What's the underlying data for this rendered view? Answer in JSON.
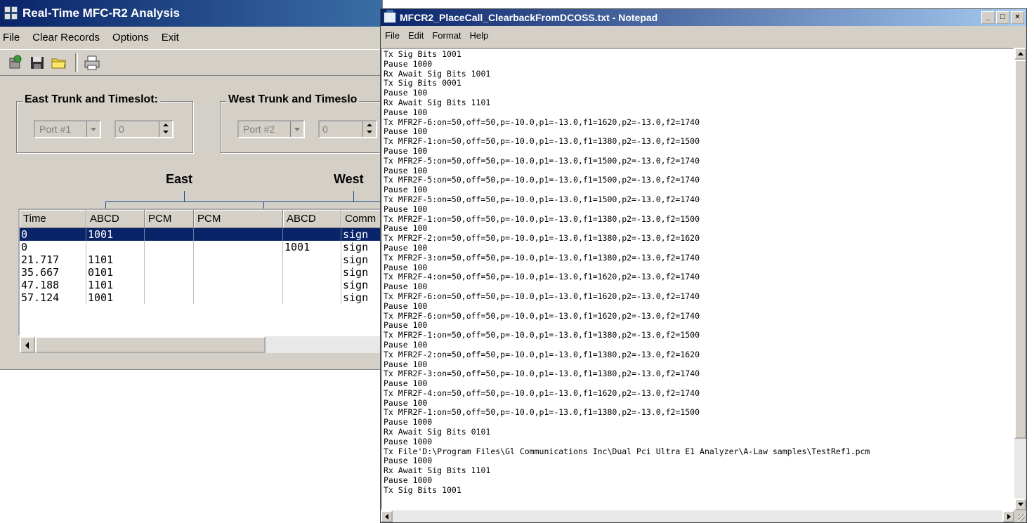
{
  "analysis": {
    "title": "Real-Time MFC-R2 Analysis",
    "menu": [
      "File",
      "Clear Records",
      "Options",
      "Exit"
    ],
    "toolbar": [
      "record-icon",
      "save-icon",
      "open-folder-icon",
      "print-icon"
    ],
    "east_group": {
      "label": "East Trunk and Timeslot:",
      "port": "Port #1",
      "timeslot": "0"
    },
    "west_group": {
      "label": "West Trunk and Timeslo",
      "port": "Port #2",
      "timeslot": "0"
    },
    "east_label": "East",
    "west_label": "West",
    "columns": [
      "Time",
      "ABCD",
      "PCM",
      "PCM",
      "ABCD",
      "Comm"
    ],
    "rows": [
      [
        "0",
        "1001",
        "",
        "",
        "",
        "sign"
      ],
      [
        "0",
        "",
        "",
        "",
        "1001",
        "sign"
      ],
      [
        "21.717",
        "1101",
        "",
        "",
        "",
        "sign"
      ],
      [
        "35.667",
        "0101",
        "",
        "",
        "",
        "sign"
      ],
      [
        "47.188",
        "1101",
        "",
        "",
        "",
        "sign"
      ],
      [
        "57.124",
        "1001",
        "",
        "",
        "",
        "sign"
      ]
    ]
  },
  "notepad": {
    "title": "MFCR2_PlaceCall_ClearbackFromDCOSS.txt - Notepad",
    "menu": [
      "File",
      "Edit",
      "Format",
      "Help"
    ],
    "title_buttons": [
      "_",
      "□",
      "×"
    ],
    "lines": [
      "Tx Sig Bits 1001",
      "Pause 1000",
      "Rx Await Sig Bits 1001",
      "Tx Sig Bits 0001",
      "Pause 100",
      "Rx Await Sig Bits 1101",
      "Pause 100",
      "Tx MFR2F-6:on=50,off=50,p=-10.0,p1=-13.0,f1=1620,p2=-13.0,f2=1740",
      "Pause 100",
      "Tx MFR2F-1:on=50,off=50,p=-10.0,p1=-13.0,f1=1380,p2=-13.0,f2=1500",
      "Pause 100",
      "Tx MFR2F-5:on=50,off=50,p=-10.0,p1=-13.0,f1=1500,p2=-13.0,f2=1740",
      "Pause 100",
      "Tx MFR2F-5:on=50,off=50,p=-10.0,p1=-13.0,f1=1500,p2=-13.0,f2=1740",
      "Pause 100",
      "Tx MFR2F-5:on=50,off=50,p=-10.0,p1=-13.0,f1=1500,p2=-13.0,f2=1740",
      "Pause 100",
      "Tx MFR2F-1:on=50,off=50,p=-10.0,p1=-13.0,f1=1380,p2=-13.0,f2=1500",
      "Pause 100",
      "Tx MFR2F-2:on=50,off=50,p=-10.0,p1=-13.0,f1=1380,p2=-13.0,f2=1620",
      "Pause 100",
      "Tx MFR2F-3:on=50,off=50,p=-10.0,p1=-13.0,f1=1380,p2=-13.0,f2=1740",
      "Pause 100",
      "Tx MFR2F-4:on=50,off=50,p=-10.0,p1=-13.0,f1=1620,p2=-13.0,f2=1740",
      "Pause 100",
      "Tx MFR2F-6:on=50,off=50,p=-10.0,p1=-13.0,f1=1620,p2=-13.0,f2=1740",
      "Pause 100",
      "Tx MFR2F-6:on=50,off=50,p=-10.0,p1=-13.0,f1=1620,p2=-13.0,f2=1740",
      "Pause 100",
      "Tx MFR2F-1:on=50,off=50,p=-10.0,p1=-13.0,f1=1380,p2=-13.0,f2=1500",
      "Pause 100",
      "Tx MFR2F-2:on=50,off=50,p=-10.0,p1=-13.0,f1=1380,p2=-13.0,f2=1620",
      "Pause 100",
      "Tx MFR2F-3:on=50,off=50,p=-10.0,p1=-13.0,f1=1380,p2=-13.0,f2=1740",
      "Pause 100",
      "Tx MFR2F-4:on=50,off=50,p=-10.0,p1=-13.0,f1=1620,p2=-13.0,f2=1740",
      "Pause 100",
      "Tx MFR2F-1:on=50,off=50,p=-10.0,p1=-13.0,f1=1380,p2=-13.0,f2=1500",
      "Pause 1000",
      "Rx Await Sig Bits 0101",
      "Pause 1000",
      "Tx File'D:\\Program Files\\Gl Communications Inc\\Dual Pci Ultra E1 Analyzer\\A-Law samples\\TestRef1.pcm",
      "Pause 1000",
      "Rx Await Sig Bits 1101",
      "Pause 1000",
      "Tx Sig Bits 1001"
    ]
  }
}
